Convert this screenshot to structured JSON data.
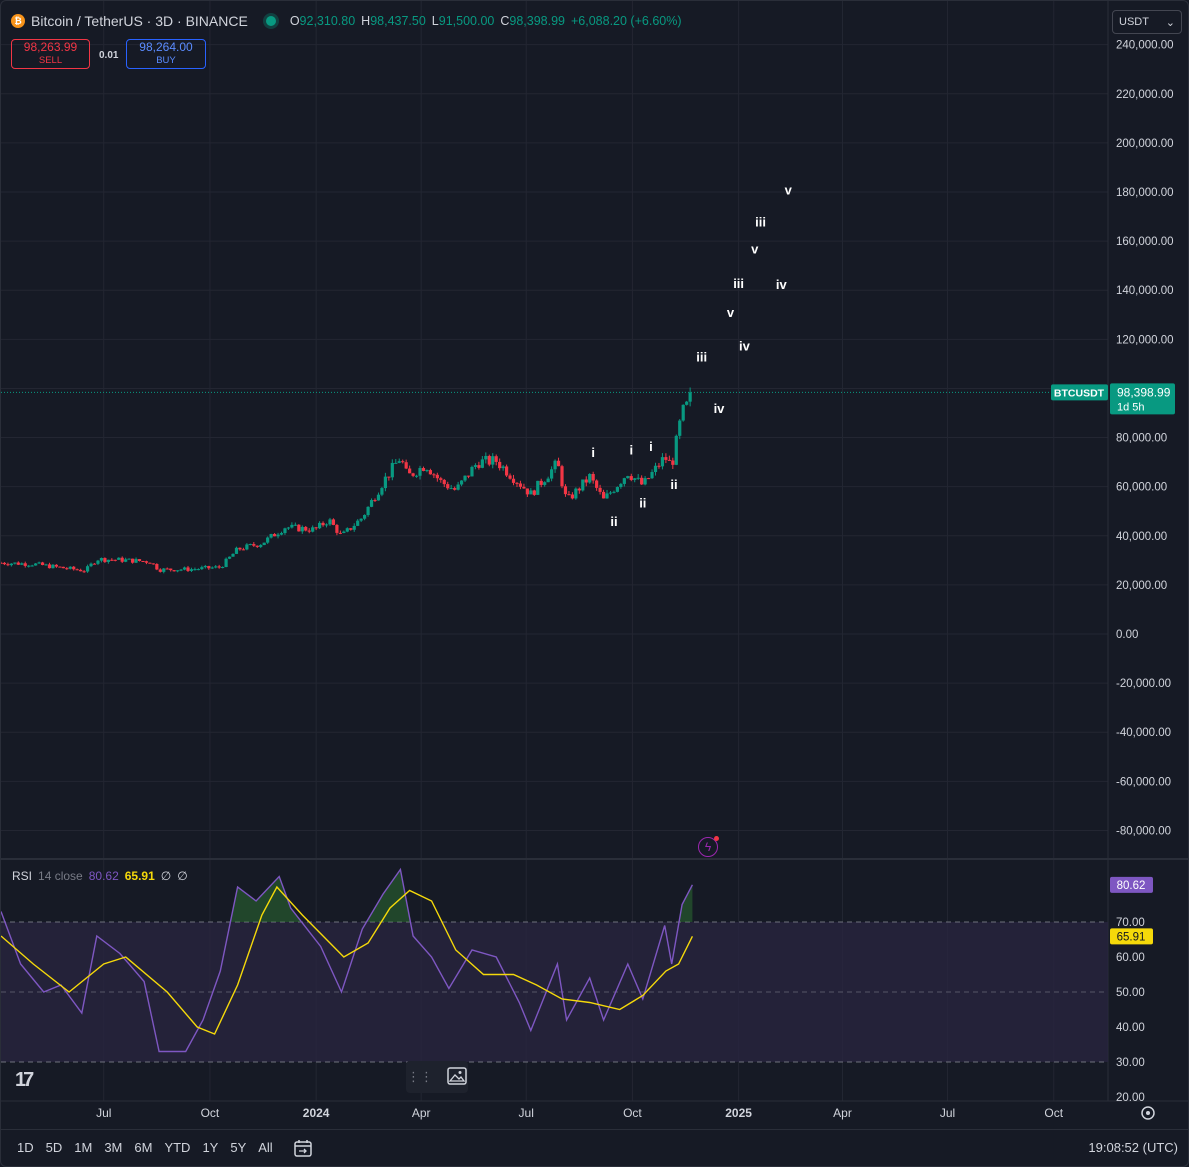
{
  "header": {
    "coin_symbol": "₿",
    "title": "Bitcoin / TetherUS · 3D · BINANCE",
    "ohlc": [
      {
        "k": "O",
        "v": "92,310.80"
      },
      {
        "k": "H",
        "v": "98,437.50"
      },
      {
        "k": "L",
        "v": "91,500.00"
      },
      {
        "k": "C",
        "v": "98,398.99"
      },
      {
        "k": "",
        "v": "+6,088.20 (+6.60%)"
      }
    ]
  },
  "trade": {
    "sell_price": "98,263.99",
    "sell_label": "SELL",
    "lot": "0.01",
    "buy_price": "98,264.00",
    "buy_label": "BUY"
  },
  "currency": {
    "label": "USDT",
    "chevron": "⌄"
  },
  "price_tag": {
    "symbol": "BTCUSDT",
    "price": "98,398.99",
    "countdown": "1d 5h"
  },
  "rsi": {
    "name": "RSI",
    "params": "14 close",
    "value": "80.62",
    "ma": "65.91",
    "extra1": "∅",
    "extra2": "∅",
    "value_color": "#7e57c2",
    "ma_color": "#f5d90a"
  },
  "timeframes": [
    "1D",
    "5D",
    "1M",
    "3M",
    "6M",
    "YTD",
    "1Y",
    "5Y",
    "All"
  ],
  "calendar_icon": "calendar-range-icon",
  "clock": "19:08:52 (UTC)",
  "colors": {
    "up": "#089981",
    "down": "#f23645",
    "bg": "#161a25",
    "grid": "#232632",
    "rsi_band": "#2a2540"
  },
  "chart_data": [
    {
      "type": "candlestick",
      "title": "Bitcoin / TetherUS · 3D · BINANCE",
      "y_ticks": [
        240000,
        220000,
        200000,
        180000,
        160000,
        140000,
        120000,
        100000,
        80000,
        60000,
        40000,
        20000,
        0,
        -20000,
        -40000,
        -60000,
        -80000
      ],
      "y_tick_labels": [
        "240,000.00",
        "220,000.00",
        "200,000.00",
        "180,000.00",
        "160,000.00",
        "140,000.00",
        "120,000.00",
        "100,000.00",
        "80,000.00",
        "60,000.00",
        "40,000.00",
        "20,000.00",
        "0.00",
        "-20,000.00",
        "-40,000.00",
        "-60,000.00",
        "-80,000.00"
      ],
      "ylim": [
        -90000,
        250000
      ],
      "x_labels": [
        "Jul",
        "Oct",
        "2024",
        "Apr",
        "Jul",
        "Oct",
        "2025",
        "Apr",
        "Jul",
        "Oct"
      ],
      "x_label_dates": [
        "2023-07-01",
        "2023-10-01",
        "2024-01-01",
        "2024-04-01",
        "2024-07-01",
        "2024-10-01",
        "2025-01-01",
        "2025-04-01",
        "2025-07-01",
        "2025-10-01"
      ],
      "xlim": [
        "2023-04-03",
        "2025-11-17"
      ],
      "last_price": 98398.99,
      "close_series": [
        {
          "d": "2023-04-03",
          "c": 29000
        },
        {
          "d": "2023-05-01",
          "c": 28500
        },
        {
          "d": "2023-05-25",
          "c": 27000
        },
        {
          "d": "2023-06-15",
          "c": 25800
        },
        {
          "d": "2023-06-25",
          "c": 30500
        },
        {
          "d": "2023-07-15",
          "c": 30200
        },
        {
          "d": "2023-08-10",
          "c": 29500
        },
        {
          "d": "2023-08-18",
          "c": 26200
        },
        {
          "d": "2023-09-15",
          "c": 26400
        },
        {
          "d": "2023-10-10",
          "c": 27200
        },
        {
          "d": "2023-10-25",
          "c": 34500
        },
        {
          "d": "2023-11-15",
          "c": 37000
        },
        {
          "d": "2023-12-05",
          "c": 43500
        },
        {
          "d": "2023-12-31",
          "c": 42500
        },
        {
          "d": "2024-01-12",
          "c": 46500
        },
        {
          "d": "2024-01-23",
          "c": 39800
        },
        {
          "d": "2024-02-10",
          "c": 47500
        },
        {
          "d": "2024-02-28",
          "c": 62000
        },
        {
          "d": "2024-03-14",
          "c": 72000
        },
        {
          "d": "2024-03-20",
          "c": 64000
        },
        {
          "d": "2024-04-05",
          "c": 69000
        },
        {
          "d": "2024-04-18",
          "c": 62000
        },
        {
          "d": "2024-05-01",
          "c": 58500
        },
        {
          "d": "2024-05-20",
          "c": 70000
        },
        {
          "d": "2024-06-05",
          "c": 70500
        },
        {
          "d": "2024-06-25",
          "c": 61500
        },
        {
          "d": "2024-07-05",
          "c": 57000
        },
        {
          "d": "2024-07-28",
          "c": 69500
        },
        {
          "d": "2024-08-05",
          "c": 54000
        },
        {
          "d": "2024-08-25",
          "c": 64000
        },
        {
          "d": "2024-09-06",
          "c": 54500
        },
        {
          "d": "2024-09-27",
          "c": 65800
        },
        {
          "d": "2024-10-10",
          "c": 60500
        },
        {
          "d": "2024-10-29",
          "c": 72000
        },
        {
          "d": "2024-11-04",
          "c": 68500
        },
        {
          "d": "2024-11-13",
          "c": 90000
        },
        {
          "d": "2024-11-19",
          "c": 94000
        },
        {
          "d": "2024-11-22",
          "c": 98398.99
        }
      ],
      "wave_labels": [
        {
          "text": "i",
          "d": "2024-08-28",
          "y": 72000
        },
        {
          "text": "ii",
          "d": "2024-09-15",
          "y": 44000
        },
        {
          "text": "i",
          "d": "2024-09-30",
          "y": 73000
        },
        {
          "text": "ii",
          "d": "2024-10-10",
          "y": 51500
        },
        {
          "text": "i",
          "d": "2024-10-17",
          "y": 74500
        },
        {
          "text": "ii",
          "d": "2024-11-06",
          "y": 59000
        },
        {
          "text": "iii",
          "d": "2024-11-30",
          "y": 111000
        },
        {
          "text": "iv",
          "d": "2024-12-15",
          "y": 90000
        },
        {
          "text": "v",
          "d": "2024-12-25",
          "y": 129000
        },
        {
          "text": "iii",
          "d": "2025-01-01",
          "y": 141000
        },
        {
          "text": "iv",
          "d": "2025-01-06",
          "y": 115500
        },
        {
          "text": "v",
          "d": "2025-01-15",
          "y": 155000
        },
        {
          "text": "iii",
          "d": "2025-01-20",
          "y": 166000
        },
        {
          "text": "iv",
          "d": "2025-02-07",
          "y": 140500
        },
        {
          "text": "v",
          "d": "2025-02-13",
          "y": 179000
        }
      ]
    },
    {
      "type": "line",
      "title": "RSI 14 close",
      "ylim": [
        20,
        90
      ],
      "y_ticks": [
        70,
        60,
        50,
        40,
        30,
        20
      ],
      "y_tick_labels": [
        "70.00",
        "60.00",
        "50.00",
        "40.00",
        "30.00",
        "20.00"
      ],
      "bands": [
        70,
        50,
        30
      ],
      "series": [
        {
          "name": "RSI",
          "color": "#7e57c2",
          "values": [
            {
              "d": "2023-04-03",
              "v": 73
            },
            {
              "d": "2023-04-20",
              "v": 58
            },
            {
              "d": "2023-05-10",
              "v": 50
            },
            {
              "d": "2023-05-25",
              "v": 52
            },
            {
              "d": "2023-06-12",
              "v": 44
            },
            {
              "d": "2023-06-25",
              "v": 66
            },
            {
              "d": "2023-07-15",
              "v": 61
            },
            {
              "d": "2023-08-05",
              "v": 53
            },
            {
              "d": "2023-08-18",
              "v": 33
            },
            {
              "d": "2023-09-10",
              "v": 33
            },
            {
              "d": "2023-09-25",
              "v": 42
            },
            {
              "d": "2023-10-10",
              "v": 56
            },
            {
              "d": "2023-10-25",
              "v": 80
            },
            {
              "d": "2023-11-10",
              "v": 76
            },
            {
              "d": "2023-11-30",
              "v": 83
            },
            {
              "d": "2023-12-10",
              "v": 74
            },
            {
              "d": "2024-01-05",
              "v": 63
            },
            {
              "d": "2024-01-23",
              "v": 50
            },
            {
              "d": "2024-02-10",
              "v": 68
            },
            {
              "d": "2024-02-28",
              "v": 78
            },
            {
              "d": "2024-03-14",
              "v": 85
            },
            {
              "d": "2024-03-25",
              "v": 66
            },
            {
              "d": "2024-04-10",
              "v": 60
            },
            {
              "d": "2024-04-25",
              "v": 51
            },
            {
              "d": "2024-05-15",
              "v": 62
            },
            {
              "d": "2024-06-05",
              "v": 60
            },
            {
              "d": "2024-06-25",
              "v": 47
            },
            {
              "d": "2024-07-05",
              "v": 39
            },
            {
              "d": "2024-07-28",
              "v": 58
            },
            {
              "d": "2024-08-05",
              "v": 42
            },
            {
              "d": "2024-08-25",
              "v": 54
            },
            {
              "d": "2024-09-06",
              "v": 42
            },
            {
              "d": "2024-09-27",
              "v": 58
            },
            {
              "d": "2024-10-10",
              "v": 48
            },
            {
              "d": "2024-10-29",
              "v": 69
            },
            {
              "d": "2024-11-04",
              "v": 58
            },
            {
              "d": "2024-11-13",
              "v": 75
            },
            {
              "d": "2024-11-22",
              "v": 80.62
            }
          ]
        },
        {
          "name": "RSI-based MA",
          "color": "#f5d90a",
          "values": [
            {
              "d": "2023-04-03",
              "v": 66
            },
            {
              "d": "2023-05-01",
              "v": 58
            },
            {
              "d": "2023-06-01",
              "v": 50
            },
            {
              "d": "2023-07-01",
              "v": 58
            },
            {
              "d": "2023-07-20",
              "v": 60
            },
            {
              "d": "2023-08-25",
              "v": 50
            },
            {
              "d": "2023-09-20",
              "v": 40
            },
            {
              "d": "2023-10-05",
              "v": 38
            },
            {
              "d": "2023-10-25",
              "v": 52
            },
            {
              "d": "2023-11-15",
              "v": 72
            },
            {
              "d": "2023-11-28",
              "v": 80
            },
            {
              "d": "2023-12-20",
              "v": 72
            },
            {
              "d": "2024-01-10",
              "v": 65
            },
            {
              "d": "2024-01-25",
              "v": 60
            },
            {
              "d": "2024-02-15",
              "v": 64
            },
            {
              "d": "2024-03-05",
              "v": 74
            },
            {
              "d": "2024-03-22",
              "v": 79
            },
            {
              "d": "2024-04-10",
              "v": 76
            },
            {
              "d": "2024-05-01",
              "v": 62
            },
            {
              "d": "2024-05-25",
              "v": 55
            },
            {
              "d": "2024-06-20",
              "v": 55
            },
            {
              "d": "2024-07-10",
              "v": 52
            },
            {
              "d": "2024-08-01",
              "v": 48
            },
            {
              "d": "2024-08-25",
              "v": 47
            },
            {
              "d": "2024-09-20",
              "v": 45
            },
            {
              "d": "2024-10-10",
              "v": 49
            },
            {
              "d": "2024-10-30",
              "v": 56
            },
            {
              "d": "2024-11-10",
              "v": 58
            },
            {
              "d": "2024-11-22",
              "v": 65.91
            }
          ]
        }
      ]
    }
  ]
}
